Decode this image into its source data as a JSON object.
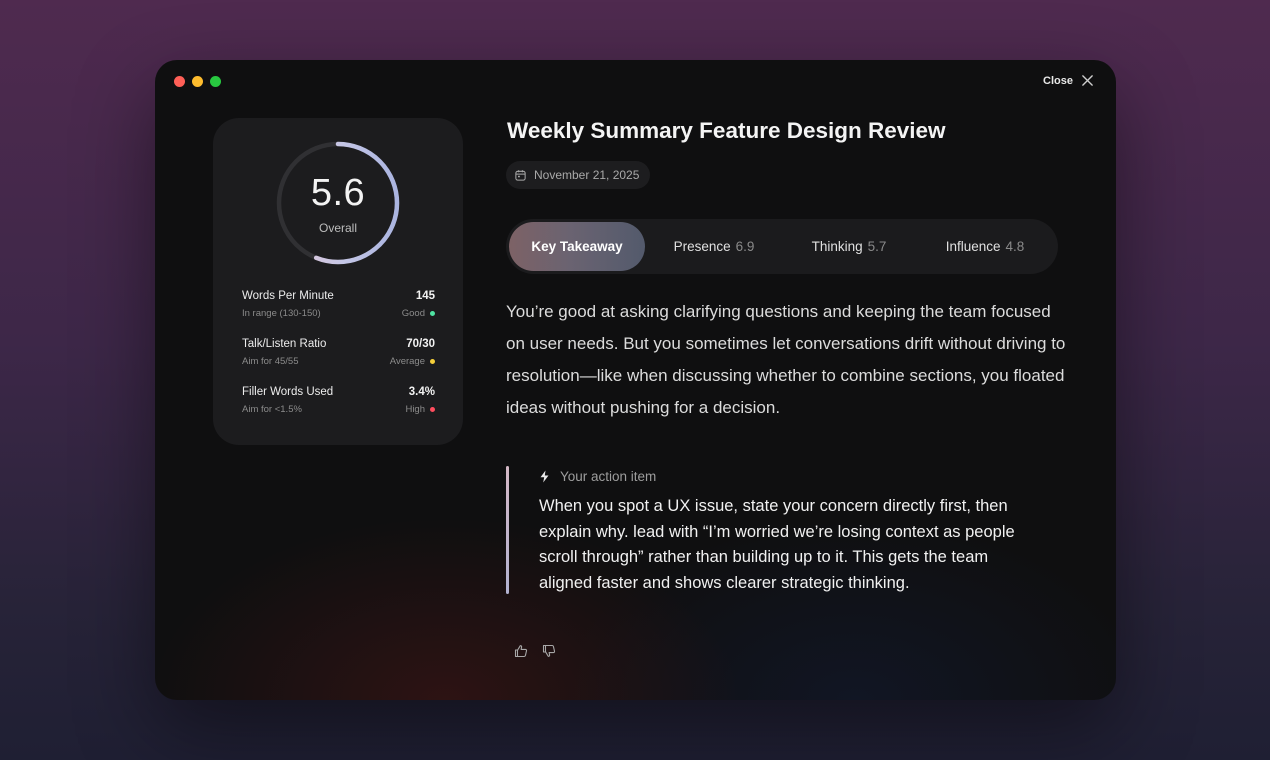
{
  "window": {
    "close_label": "Close"
  },
  "score": {
    "value": "5.6",
    "label": "Overall",
    "fraction": 0.56
  },
  "metrics": [
    {
      "name": "Words Per Minute",
      "sub": "In range (130-150)",
      "value": "145",
      "status": "Good",
      "status_color": "#4fe3a3"
    },
    {
      "name": "Talk/Listen Ratio",
      "sub": "Aim for 45/55",
      "value": "70/30",
      "status": "Average",
      "status_color": "#f5cf3a"
    },
    {
      "name": "Filler Words Used",
      "sub": "Aim for <1.5%",
      "value": "3.4%",
      "status": "High",
      "status_color": "#ff4d5e"
    }
  ],
  "title": "Weekly Summary Feature Design Review",
  "date": "November 21, 2025",
  "tabs": [
    {
      "label": "Key Takeaway",
      "score": "",
      "active": true
    },
    {
      "label": "Presence",
      "score": "6.9",
      "active": false
    },
    {
      "label": "Thinking",
      "score": "5.7",
      "active": false
    },
    {
      "label": "Influence",
      "score": "4.8",
      "active": false
    }
  ],
  "summary": "You’re good at asking clarifying questions and keeping the team focused on user needs. But you sometimes let conversations drift without driving to resolution—like when discussing whether to combine sections, you floated ideas without pushing for a decision.",
  "action_item": {
    "heading": "Your action item",
    "text": "When you spot a UX issue, state your concern directly first, then explain why. lead with “I’m worried we’re losing context as people scroll through” rather than building up to it. This gets the team aligned faster and shows clearer strategic thinking."
  },
  "icons": {
    "close": "close-icon",
    "calendar": "calendar-icon",
    "action": "lightning-icon",
    "thumbs_up": "thumbs-up-icon",
    "thumbs_down": "thumbs-down-icon"
  }
}
